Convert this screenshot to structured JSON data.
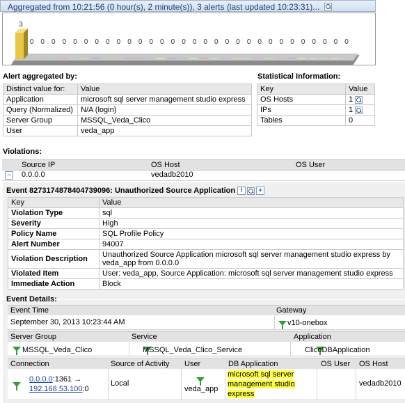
{
  "header": {
    "title": "Aggregated from 10:21:56 (0 hour(s), 2 minute(s)), 3  alerts (last updated 10:23:31)..."
  },
  "chart_data": {
    "type": "bar",
    "values": [
      3,
      0,
      0,
      0,
      0,
      0,
      0,
      0,
      0,
      0,
      0,
      0,
      0,
      0,
      0,
      0,
      0,
      0,
      0,
      0,
      0,
      0,
      0,
      0,
      0,
      0,
      0,
      0,
      0,
      0,
      0
    ],
    "bar_colors": [
      "#e8c84a",
      "#b8c8e8",
      "#d8b0d8",
      "#a8d8b8",
      "#e8b0b0",
      "#b0d8e8",
      "#d8d8a0",
      "#c0b0e8",
      "#a8e0a8",
      "#e8c0a0",
      "#b8b8e8",
      "#e0a8c8",
      "#a0d0d0",
      "#e8e0a0",
      "#c8a8e0",
      "#a8c8e8",
      "#d0e8a8",
      "#e8a8a8",
      "#a8e8d0",
      "#d0b8e8",
      "#e8d0a8",
      "#b0e0e0",
      "#e0b0e0",
      "#c8e8a8",
      "#e8b8c8",
      "#a8b8e8",
      "#d8e8b8",
      "#e8c8e8",
      "#b8e8c8",
      "#e8d8b8",
      "#c0d0e8"
    ]
  },
  "alert_aggregated": {
    "title": "Alert aggregated by:",
    "headers": [
      "Distinct value for:",
      "Value"
    ],
    "rows": [
      [
        "Application",
        "microsoft sql server management studio express"
      ],
      [
        "Query (Normalized)",
        "N/A (login)"
      ],
      [
        "Server Group",
        "MSSQL_Veda_Clico"
      ],
      [
        "User",
        "veda_app"
      ]
    ]
  },
  "stats": {
    "title": "Statistical Information:",
    "headers": [
      "Key",
      "Value"
    ],
    "rows": [
      [
        "OS Hosts",
        "1"
      ],
      [
        "IPs",
        "1"
      ],
      [
        "Tables",
        "0"
      ]
    ]
  },
  "violations": {
    "title": "Violations:",
    "headers": [
      "Source IP",
      "OS Host",
      "OS User"
    ],
    "row": [
      "0.0.0.0",
      "vedadb2010",
      ""
    ]
  },
  "event": {
    "title": "Event  8273174878404739096:  Unauthorized Source Application",
    "headers": [
      "Key",
      "Value"
    ],
    "rows": [
      [
        "Violation Type",
        "sql"
      ],
      [
        "Severity",
        "High"
      ],
      [
        "Policy Name",
        "SQL Profile Policy"
      ],
      [
        "Alert Number",
        "94007"
      ],
      [
        "Violation Description",
        "Unauthorized Source Application microsoft sql server management studio express by veda_app from 0.0.0.0"
      ],
      [
        "Violated Item",
        "User: veda_app, Source Application: microsoft sql server management studio express"
      ],
      [
        "Immediate Action",
        "Block"
      ]
    ]
  },
  "event_details": {
    "title": "Event Details:",
    "time_header": "Event Time",
    "gateway_header": "Gateway",
    "time": "September 30, 2013 10:23:44 AM",
    "gateway": "v10-onebox",
    "sg_header": "Server Group",
    "svc_header": "Service",
    "app_header": "Application",
    "server_group": "MSSQL_Veda_Clico",
    "service": "MSSQL_Veda_Clico_Service",
    "application": "ClicoDBApplication",
    "conn_headers": [
      "Connection",
      "Source of Activity",
      "User",
      "DB Application",
      "OS User",
      "OS Host"
    ],
    "conn_src": "0.0.0.0",
    "conn_src_port": ":1361 →",
    "conn_dst": "192.168.53.100",
    "conn_dst_port": ":0",
    "source_of_activity": "Local",
    "user": "veda_app",
    "db_app_lines": [
      "microsoft sql server",
      "management studio",
      "express"
    ],
    "os_user": "",
    "os_host": "vedadb2010"
  },
  "chart_label": "3"
}
